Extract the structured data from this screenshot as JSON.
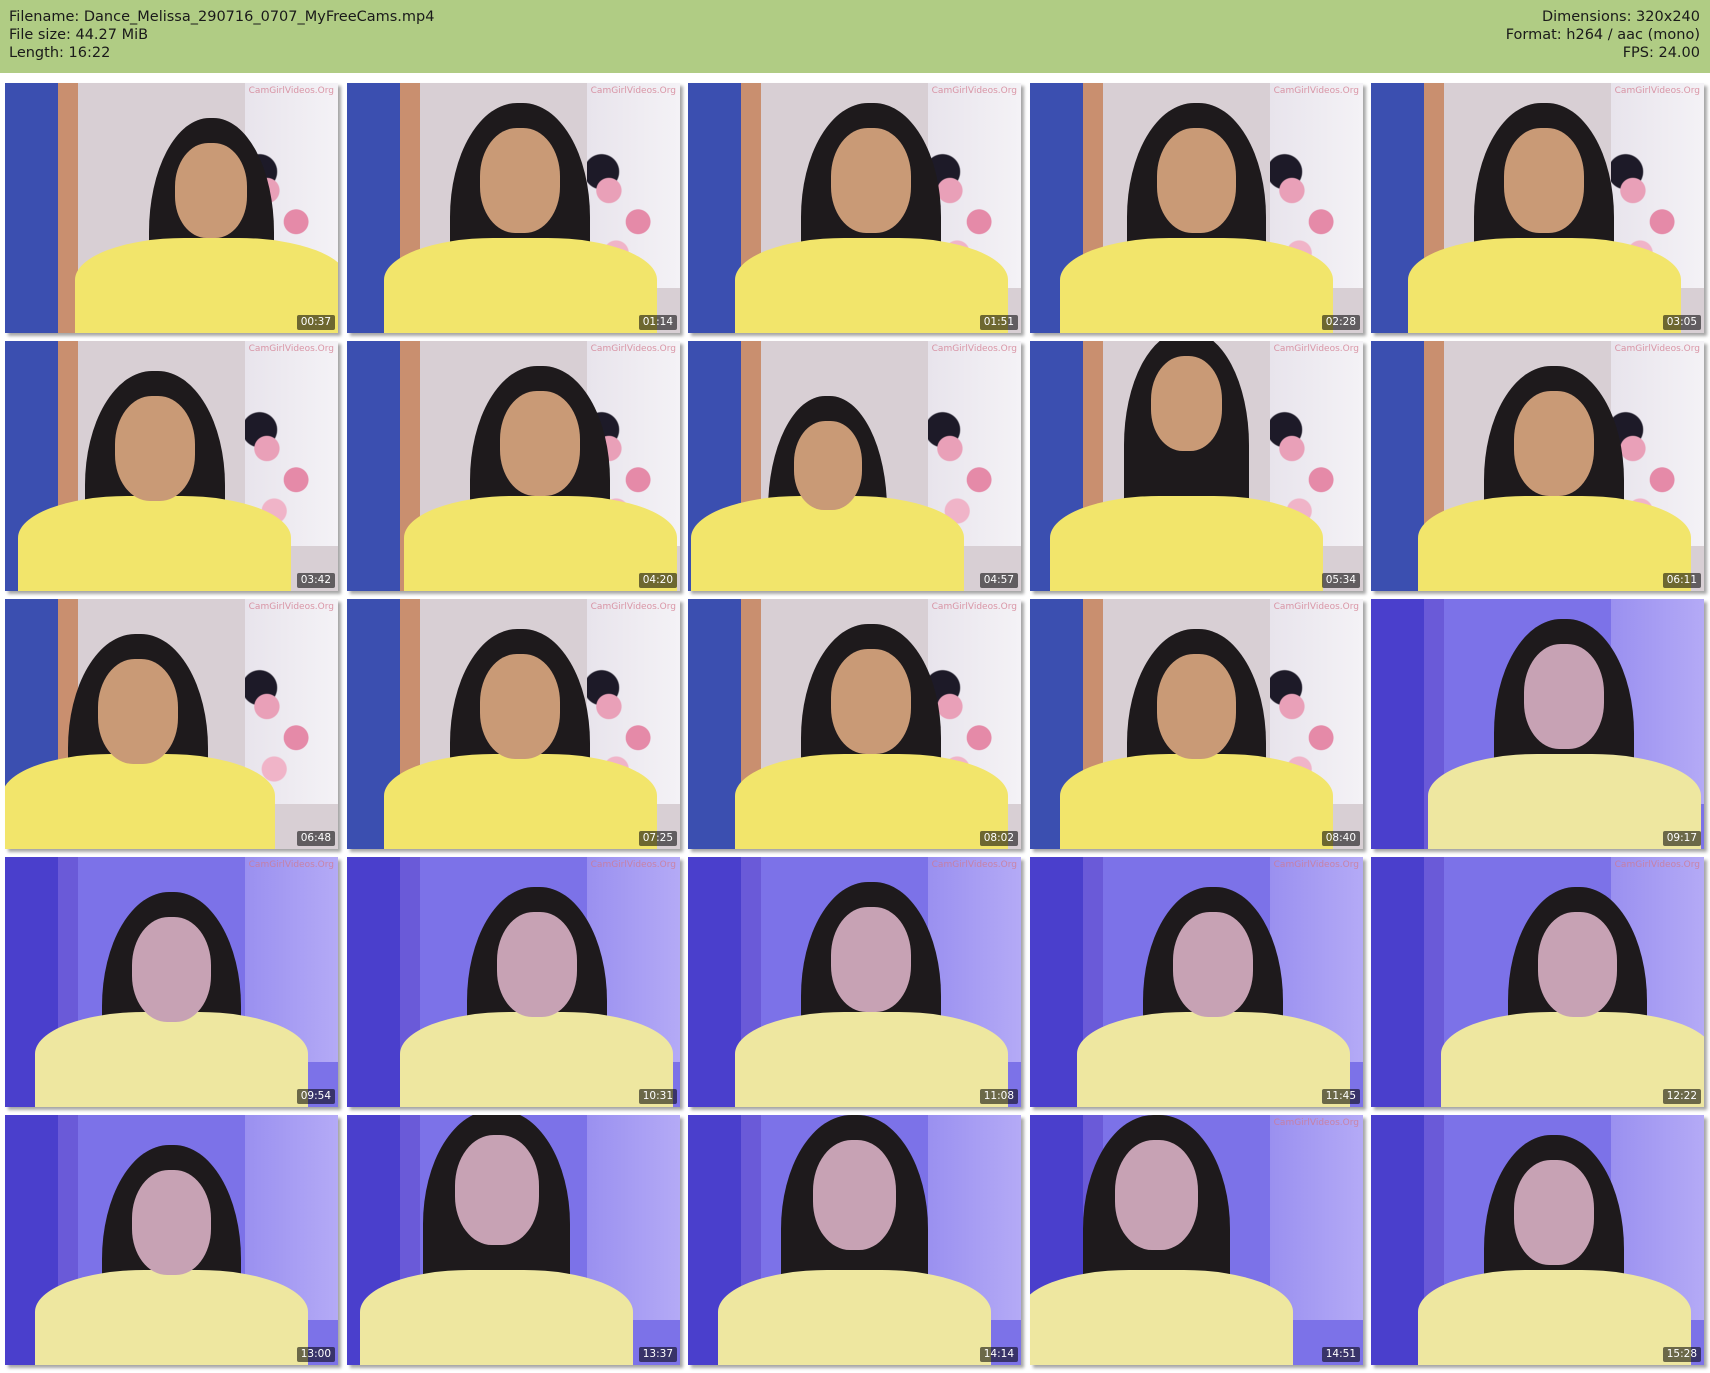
{
  "header": {
    "filename": "Filename: Dance_Melissa_290716_0707_MyFreeCams.mp4",
    "filesize": "File size: 44.27 MiB",
    "length": "Length: 16:22",
    "dimensions": "Dimensions: 320x240",
    "format": "Format: h264 / aac (mono)",
    "fps": "FPS: 24.00"
  },
  "colors": {
    "header_bg": "#b0cc84",
    "shirt": "#f2e56b",
    "hair": "#1e1a1c"
  },
  "thumbnails": [
    {
      "time": "00:37",
      "watermark": "CamGirlVideos.Org",
      "lighting": "warm"
    },
    {
      "time": "01:14",
      "watermark": "CamGirlVideos.Org",
      "lighting": "warm"
    },
    {
      "time": "01:51",
      "watermark": "CamGirlVideos.Org",
      "lighting": "warm"
    },
    {
      "time": "02:28",
      "watermark": "CamGirlVideos.Org",
      "lighting": "warm"
    },
    {
      "time": "03:05",
      "watermark": "CamGirlVideos.Org",
      "lighting": "warm"
    },
    {
      "time": "03:42",
      "watermark": "CamGirlVideos.Org",
      "lighting": "warm"
    },
    {
      "time": "04:20",
      "watermark": "CamGirlVideos.Org",
      "lighting": "warm"
    },
    {
      "time": "04:57",
      "watermark": "CamGirlVideos.Org",
      "lighting": "warm"
    },
    {
      "time": "05:34",
      "watermark": "CamGirlVideos.Org",
      "lighting": "warm"
    },
    {
      "time": "06:11",
      "watermark": "CamGirlVideos.Org",
      "lighting": "warm"
    },
    {
      "time": "06:48",
      "watermark": "CamGirlVideos.Org",
      "lighting": "warm"
    },
    {
      "time": "07:25",
      "watermark": "CamGirlVideos.Org",
      "lighting": "warm"
    },
    {
      "time": "08:02",
      "watermark": "CamGirlVideos.Org",
      "lighting": "warm"
    },
    {
      "time": "08:40",
      "watermark": "CamGirlVideos.Org",
      "lighting": "warm"
    },
    {
      "time": "09:17",
      "watermark": "",
      "lighting": "blue"
    },
    {
      "time": "09:54",
      "watermark": "CamGirlVideos.Org",
      "lighting": "blue"
    },
    {
      "time": "10:31",
      "watermark": "CamGirlVideos.Org",
      "lighting": "blue"
    },
    {
      "time": "11:08",
      "watermark": "CamGirlVideos.Org",
      "lighting": "blue"
    },
    {
      "time": "11:45",
      "watermark": "CamGirlVideos.Org",
      "lighting": "blue"
    },
    {
      "time": "12:22",
      "watermark": "CamGirlVideos.Org",
      "lighting": "blue"
    },
    {
      "time": "13:00",
      "watermark": "",
      "lighting": "blue"
    },
    {
      "time": "13:37",
      "watermark": "",
      "lighting": "blue"
    },
    {
      "time": "14:14",
      "watermark": "",
      "lighting": "blue"
    },
    {
      "time": "14:51",
      "watermark": "CamGirlVideos.Org",
      "lighting": "blue"
    },
    {
      "time": "15:28",
      "watermark": "",
      "lighting": "blue"
    }
  ]
}
